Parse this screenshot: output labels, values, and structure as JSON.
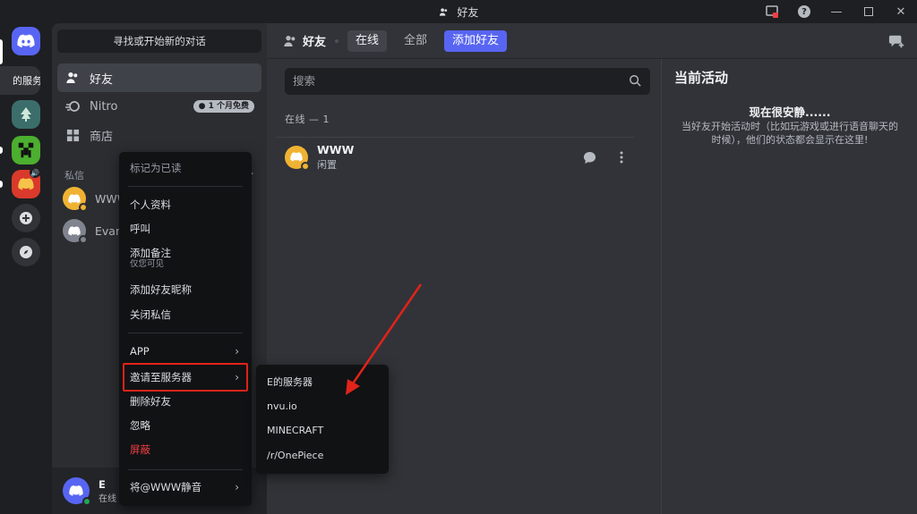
{
  "window": {
    "title": "好友"
  },
  "sidebar": {
    "search_button": "寻找或开始新的对话",
    "nav": [
      {
        "label": "好友"
      },
      {
        "label": "Nitro",
        "badge": "1 个月免费"
      },
      {
        "label": "商店"
      }
    ],
    "dm_header": "私信",
    "dm_items": [
      {
        "name": "WWW"
      },
      {
        "name": "Evan"
      }
    ],
    "server_tooltip": "的服务器"
  },
  "user": {
    "name": "E",
    "status": "在线"
  },
  "topbar": {
    "title": "好友",
    "tabs": [
      "在线",
      "全部"
    ],
    "add_friend": "添加好友"
  },
  "main": {
    "search_placeholder": "搜索",
    "online_header": "在线 — 1",
    "friend": {
      "name": "WWW",
      "status": "闲置"
    }
  },
  "activity": {
    "title": "当前活动",
    "heading": "现在很安静......",
    "body": "当好友开始活动时（比如玩游戏或进行语音聊天的时候），他们的状态都会显示在这里!"
  },
  "context_menu": {
    "mark_read": "标记为已读",
    "profile": "个人资料",
    "call": "呼叫",
    "add_note": "添加备注",
    "add_note_sub": "仅您可见",
    "add_nickname": "添加好友昵称",
    "close_dm": "关闭私信",
    "app": "APP",
    "invite": "邀请至服务器",
    "remove_friend": "删除好友",
    "ignore": "忽略",
    "block": "屏蔽",
    "mute": "将@WWW静音"
  },
  "submenu": [
    "E的服务器",
    "nvu.io",
    "MINECRAFT",
    "/r/OnePiece"
  ],
  "colors": {
    "brand": "#5865f2",
    "idle": "#f0b232",
    "online": "#23a559",
    "danger": "#f23f43",
    "highlight": "#e2231a"
  }
}
